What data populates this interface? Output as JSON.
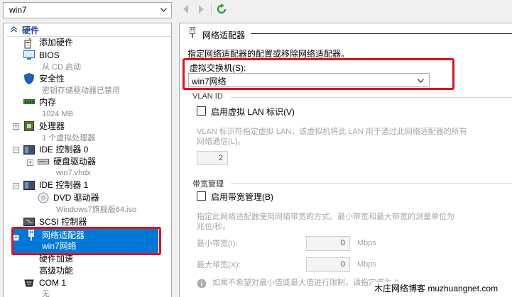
{
  "window": {
    "vm_selector": {
      "value": "win7"
    }
  },
  "colors": {
    "selection": "#0078d7",
    "annotation_red": "#e3101b",
    "header_blue": "#1f4e9b",
    "refresh_green": "#2e9e3e"
  },
  "icons": {
    "nav_back": "chevron-left-icon",
    "nav_forward": "chevron-right-icon",
    "refresh": "refresh-icon"
  },
  "tree": {
    "header": "硬件",
    "items": {
      "add_hardware": {
        "label": "添加硬件"
      },
      "bios": {
        "label": "BIOS",
        "sub": "从 CD 启动"
      },
      "security": {
        "label": "安全性",
        "sub": "密钥存储驱动器已禁用"
      },
      "memory": {
        "label": "内存",
        "sub": "1024 MB"
      },
      "processor": {
        "label": "处理器",
        "sub": "1 个虚拟处理器"
      },
      "ide0": {
        "label": "IDE 控制器 0"
      },
      "hdd": {
        "label": "硬盘驱动器",
        "sub": "win7.vhdx"
      },
      "ide1": {
        "label": "IDE 控制器 1"
      },
      "dvd": {
        "label": "DVD 驱动器",
        "sub": "Windows7旗舰版64.iso"
      },
      "scsi": {
        "label": "SCSI 控制器"
      },
      "network_adapter": {
        "label": "网络适配器",
        "sub": "win7网络"
      },
      "hw_accel": {
        "label": "硬件加速"
      },
      "advanced": {
        "label": "高级功能"
      },
      "com1": {
        "label": "COM 1",
        "sub": "无"
      }
    }
  },
  "panel": {
    "title": "网络适配器",
    "description": "指定网络适配器的配置或移除网络适配器。",
    "virtual_switch": {
      "label": "虚拟交换机(S):",
      "value": "win7网络"
    },
    "vlan": {
      "group_label": "VLAN ID",
      "checkbox_label": "启用虚拟 LAN 标识(V)",
      "checked": false,
      "help_line1": "VLAN 标识符指定虚拟 LAN，该虚拟机将此 LAN 用于通过此网络适配器的所有",
      "help_line2": "网络通信(L)。",
      "value": "2"
    },
    "bandwidth": {
      "group_label": "带宽管理",
      "checkbox_label": "启用带宽管理(B)",
      "checked": false,
      "help_line1": "指定此网络适配器使用网络带宽的方式。最小带宽和最大带宽的测量单位为",
      "help_line2": "兆位/秒。",
      "min_label": "最小带宽(I):",
      "min_value": "0",
      "max_label": "最大带宽(X):",
      "max_value": "0",
      "unit": "Mbps",
      "info_text": "如果不希望对最小值或最大值进行限制，请指定值为 0"
    }
  },
  "watermark": "木庄网络博客 muzhuangnet.com"
}
